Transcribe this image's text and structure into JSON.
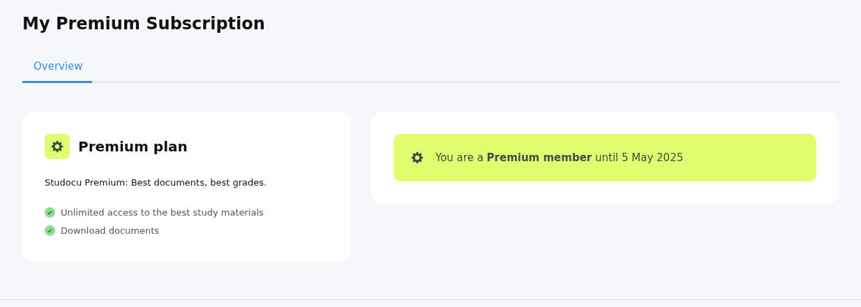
{
  "page": {
    "title": "My Premium Subscription"
  },
  "tabs": [
    {
      "label": "Overview",
      "selected": true
    }
  ],
  "plan_card": {
    "title": "Premium plan",
    "tagline": "Studocu Premium: Best documents, best grades.",
    "features": [
      "Unlimited access to the best study materials",
      "Download documents"
    ]
  },
  "membership_notice": {
    "text": "You are a **Premium member** until 5 May 2025"
  }
}
